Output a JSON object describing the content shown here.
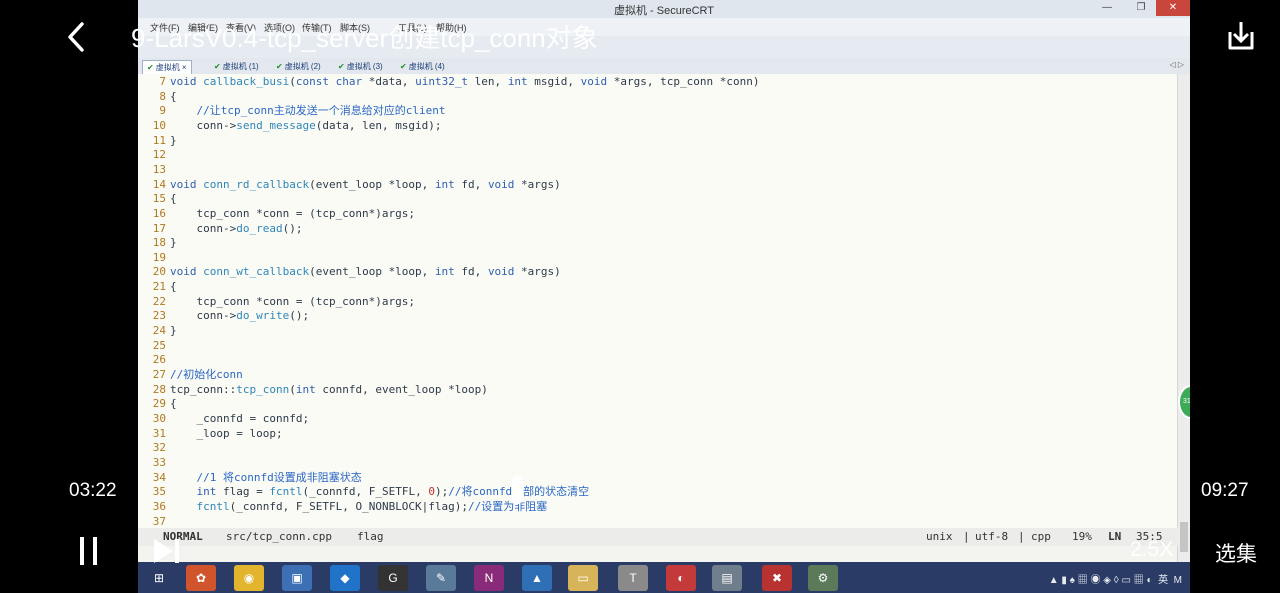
{
  "player": {
    "title": "9-LarsV0.4-tcp_server创建tcp_conn对象",
    "current_time": "03:22",
    "total_time": "09:27",
    "speed": "2.5X",
    "episodes_label": "选集",
    "progress_fraction": 0.357
  },
  "window": {
    "title": "虚拟机 - SecureCRT",
    "menus": [
      "文件(F)",
      "编辑(E)",
      "查看(V)",
      "选项(O)",
      "传输(T)",
      "脚本(S)",
      "工具(L)",
      "帮助(H)"
    ],
    "tabs": [
      "虚拟机",
      "虚拟机 (1)",
      "虚拟机 (2)",
      "虚拟机 (3)",
      "虚拟机 (4)"
    ]
  },
  "code": [
    {
      "n": "7",
      "t": "void callback_busi(const char *data, uint32_t len, int msgid, void *args, tcp_conn *conn)"
    },
    {
      "n": "8",
      "t": "{"
    },
    {
      "n": "9",
      "t": "    //让tcp_conn主动发送一个消息给对应的client"
    },
    {
      "n": "10",
      "t": "    conn->send_message(data, len, msgid);"
    },
    {
      "n": "11",
      "t": "}"
    },
    {
      "n": "12",
      "t": ""
    },
    {
      "n": "13",
      "t": ""
    },
    {
      "n": "14",
      "t": "void conn_rd_callback(event_loop *loop, int fd, void *args)"
    },
    {
      "n": "15",
      "t": "{"
    },
    {
      "n": "16",
      "t": "    tcp_conn *conn = (tcp_conn*)args;"
    },
    {
      "n": "17",
      "t": "    conn->do_read();"
    },
    {
      "n": "18",
      "t": "}"
    },
    {
      "n": "19",
      "t": ""
    },
    {
      "n": "20",
      "t": "void conn_wt_callback(event_loop *loop, int fd, void *args)"
    },
    {
      "n": "21",
      "t": "{"
    },
    {
      "n": "22",
      "t": "    tcp_conn *conn = (tcp_conn*)args;"
    },
    {
      "n": "23",
      "t": "    conn->do_write();"
    },
    {
      "n": "24",
      "t": "}"
    },
    {
      "n": "25",
      "t": ""
    },
    {
      "n": "26",
      "t": ""
    },
    {
      "n": "27",
      "t": "//初始化conn"
    },
    {
      "n": "28",
      "t": "tcp_conn::tcp_conn(int connfd, event_loop *loop)"
    },
    {
      "n": "29",
      "t": "{"
    },
    {
      "n": "30",
      "t": "    _connfd = connfd;"
    },
    {
      "n": "31",
      "t": "    _loop = loop;"
    },
    {
      "n": "32",
      "t": ""
    },
    {
      "n": "33",
      "t": ""
    },
    {
      "n": "34",
      "t": "    //1 将connfd设置成非阻塞状态"
    },
    {
      "n": "35",
      "t": "    int flag = fcntl(_connfd, F_SETFL, 0);//将connfd全部的状态清空"
    },
    {
      "n": "36",
      "t": "    fcntl(_connfd, F_SETFL, O_NONBLOCK|flag);//设置为非阻塞"
    },
    {
      "n": "37",
      "t": ""
    }
  ],
  "statusline": {
    "mode": "NORMAL",
    "file": "src/tcp_conn.cpp",
    "tag": "flag",
    "format": "unix",
    "encoding": "utf-8",
    "filetype": "cpp",
    "percent": "19%",
    "ln_label": "LN",
    "position": "35:5"
  },
  "taskbar": {
    "tray": "英",
    "tray2": "M"
  }
}
